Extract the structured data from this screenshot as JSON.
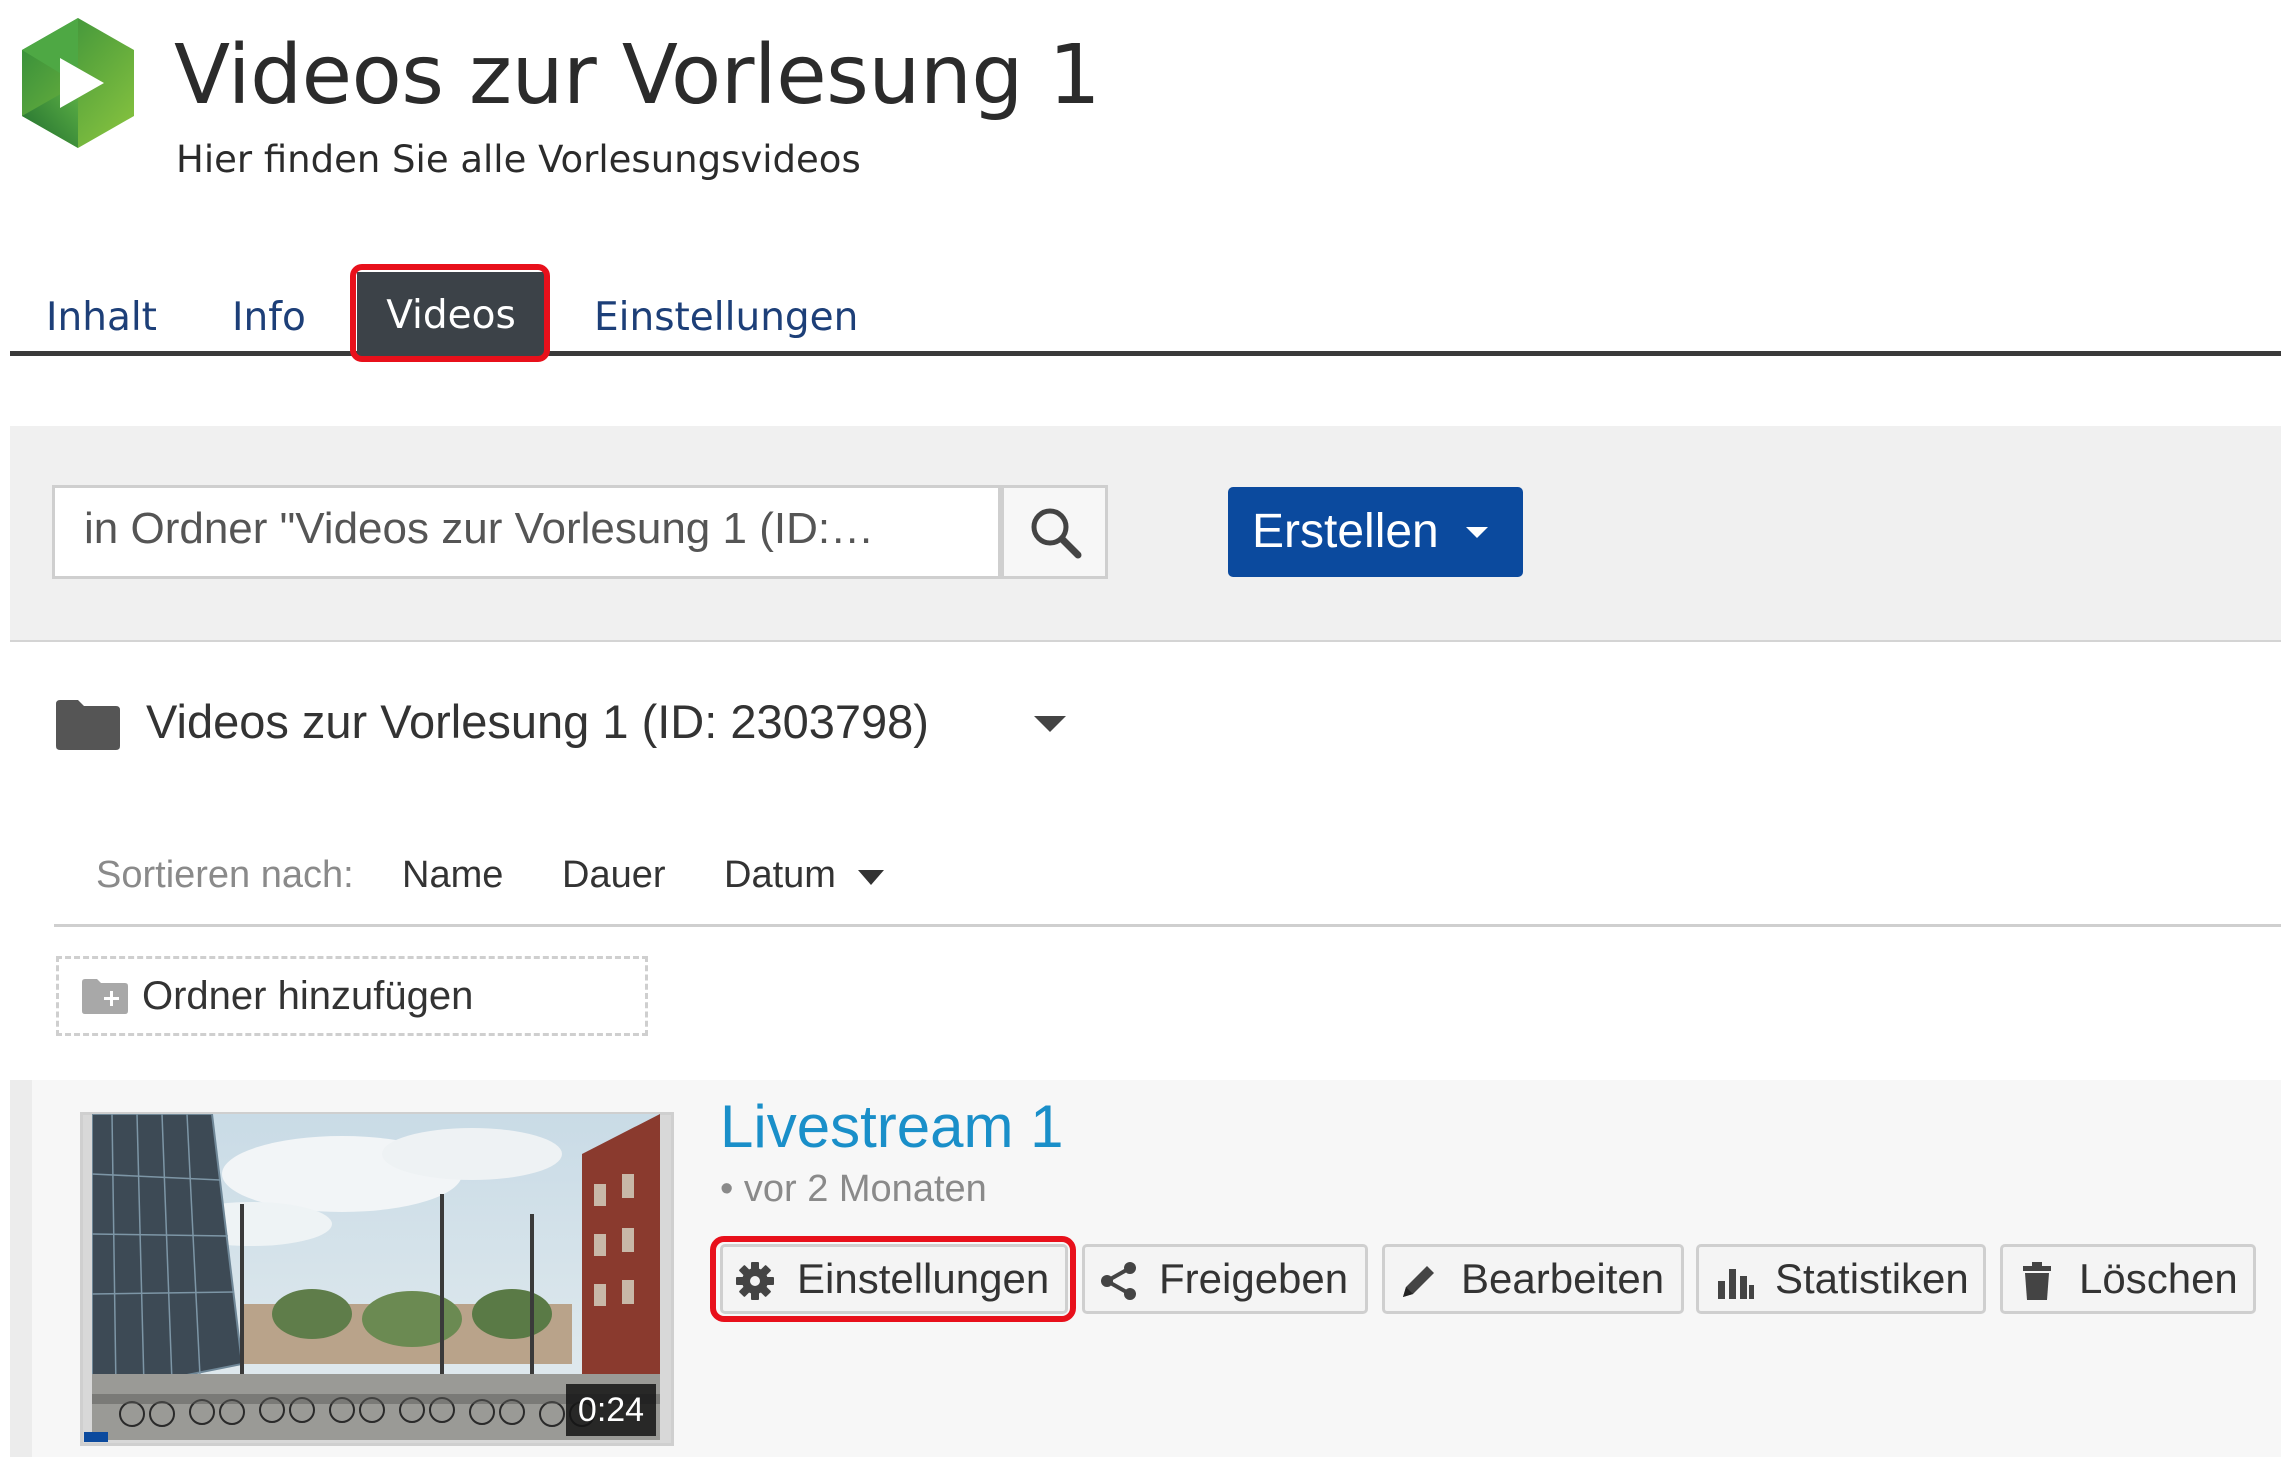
{
  "header": {
    "title": "Videos zur Vorlesung 1",
    "subtitle": "Hier finden Sie alle Vorlesungsvideos",
    "logo_icon": "panopto-play-logo-icon"
  },
  "tabs": [
    {
      "label": "Inhalt",
      "active": false
    },
    {
      "label": "Info",
      "active": false
    },
    {
      "label": "Videos",
      "active": true
    },
    {
      "label": "Einstellungen",
      "active": false
    }
  ],
  "toolbar": {
    "search_value": "in Ordner \"Videos zur Vorlesung 1 (ID:…",
    "search_icon": "search-icon",
    "create_label": "Erstellen",
    "accent": "#0b4a9e"
  },
  "folder": {
    "name": "Videos zur Vorlesung 1 (ID: 2303798)",
    "icon": "folder-icon"
  },
  "sort": {
    "label": "Sortieren nach:",
    "options": [
      "Name",
      "Dauer",
      "Datum"
    ],
    "selected": "Datum"
  },
  "add_folder": {
    "label": "Ordner hinzufügen",
    "icon": "folder-plus-icon"
  },
  "session": {
    "title": "Livestream 1",
    "meta": "• vor 2 Monaten",
    "duration": "0:24",
    "title_color": "#1a8fc9",
    "actions": [
      {
        "label": "Einstellungen",
        "icon": "gear-icon"
      },
      {
        "label": "Freigeben",
        "icon": "share-icon"
      },
      {
        "label": "Bearbeiten",
        "icon": "pencil-icon"
      },
      {
        "label": "Statistiken",
        "icon": "bar-chart-icon"
      },
      {
        "label": "Löschen",
        "icon": "trash-icon"
      }
    ]
  },
  "highlight_color": "#e8101b"
}
